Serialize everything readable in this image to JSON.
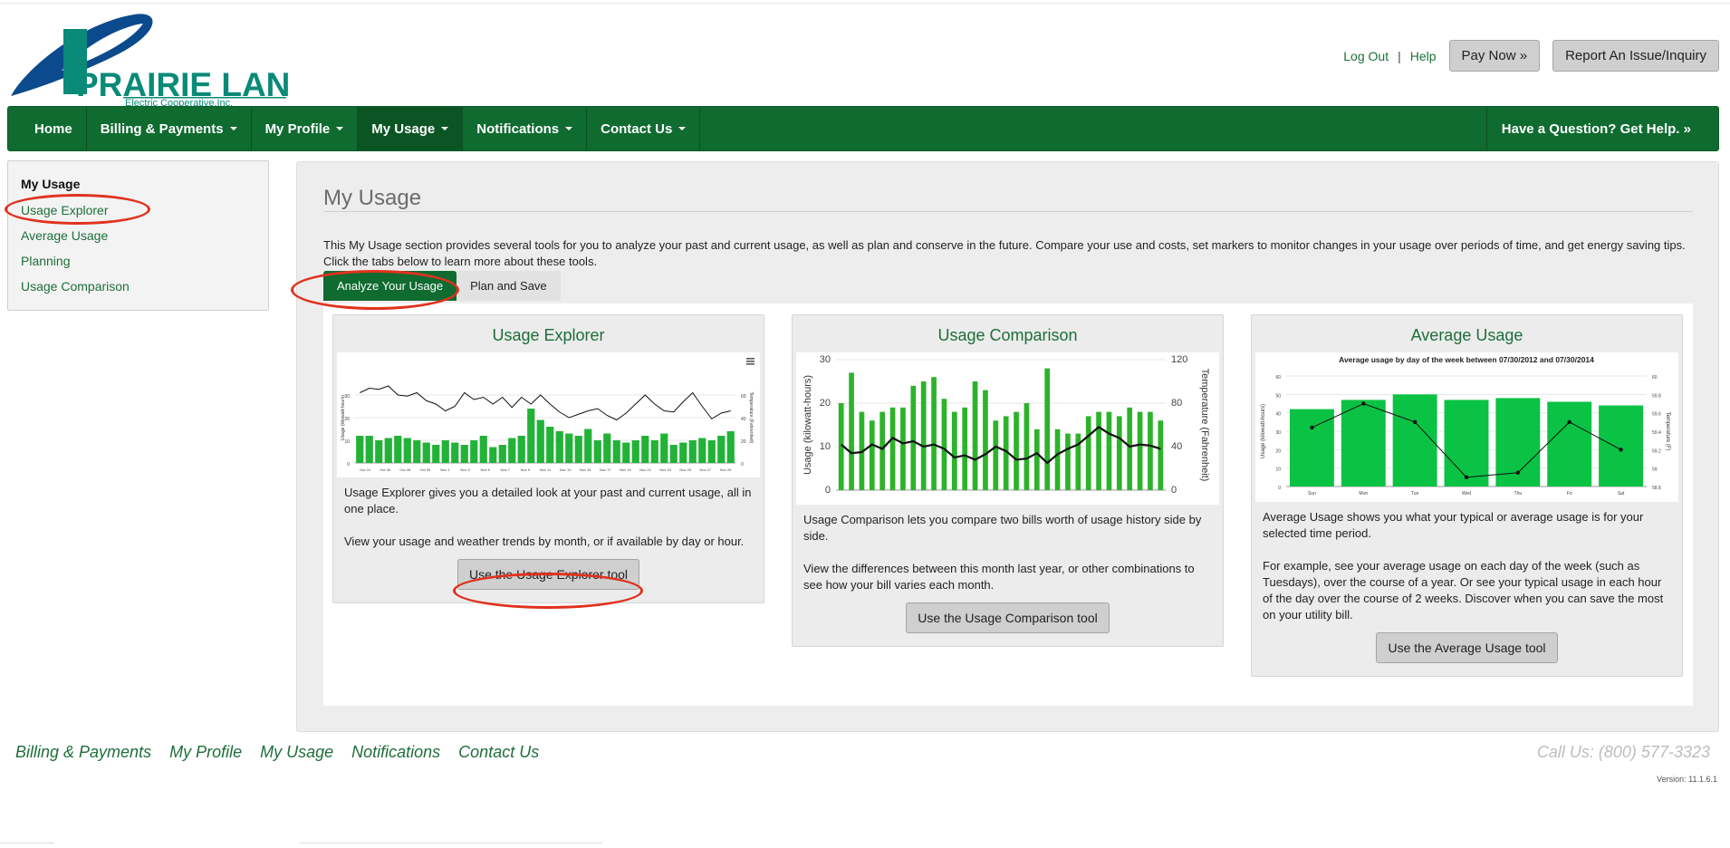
{
  "brand": {
    "name": "PRAIRIE LAND",
    "subtitle": "Electric Cooperative,Inc.",
    "green": "#0f6b30",
    "teal": "#0a8a78",
    "blue": "#0b4a8c"
  },
  "header": {
    "logout": "Log Out",
    "separator": "|",
    "help": "Help",
    "pay_now": "Pay Now »",
    "report": "Report An Issue/Inquiry"
  },
  "nav": {
    "items": [
      {
        "label": "Home",
        "dropdown": false
      },
      {
        "label": "Billing & Payments",
        "dropdown": true
      },
      {
        "label": "My Profile",
        "dropdown": true
      },
      {
        "label": "My Usage",
        "dropdown": true,
        "active": true
      },
      {
        "label": "Notifications",
        "dropdown": true
      },
      {
        "label": "Contact Us",
        "dropdown": true
      }
    ],
    "help": "Have a Question? Get Help. »"
  },
  "sidebar": {
    "title": "My Usage",
    "items": [
      "Usage Explorer",
      "Average Usage",
      "Planning",
      "Usage Comparison"
    ]
  },
  "main": {
    "title": "My Usage",
    "intro": "This My Usage section provides several tools for you to analyze your past and current usage, as well as plan and conserve in the future. Compare your use and costs, set markers to monitor changes in your usage over periods of time, and get energy saving tips. Click the tabs below to learn more about these tools.",
    "tabs": [
      "Analyze Your Usage",
      "Plan and Save"
    ]
  },
  "cards": {
    "explorer": {
      "title": "Usage Explorer",
      "text1": "Usage Explorer gives you a detailed look at your past and current usage, all in one place.",
      "text2": "View your usage and weather trends by month, or if available by day or hour.",
      "button": "Use the Usage Explorer tool"
    },
    "comparison": {
      "title": "Usage Comparison",
      "text1": "Usage Comparison lets you compare two bills worth of usage history side by side.",
      "text2": "View the differences between this month last year, or other combinations to see how your bill varies each month.",
      "button": "Use the Usage Comparison tool"
    },
    "average": {
      "title": "Average Usage",
      "text1": "Average Usage shows you what your typical or average usage is for your selected time period.",
      "text2": "For example, see your average usage on each day of the week (such as Tuesdays), over the course of a year. Or see your typical usage in each hour of the day over the course of 2 weeks. Discover when you can save the most on your utility bill.",
      "button": "Use the Average Usage tool"
    }
  },
  "chart_data": [
    {
      "type": "bar",
      "id": "explorer",
      "ylabel": "Usage (kilowatt-hours)",
      "y2label": "Temperature (Fahrenheit)",
      "ylim": [
        0,
        40
      ],
      "y2lim": [
        0,
        80
      ],
      "yticks": [
        0,
        10,
        20,
        30
      ],
      "y2ticks": [
        0,
        20,
        40,
        60
      ],
      "categories": [
        "Oct 24",
        "Oct 26",
        "Oct 28",
        "Oct 30",
        "Nov 1",
        "Nov 3",
        "Nov 5",
        "Nov 7",
        "Nov 9",
        "Nov 11",
        "Nov 13",
        "Nov 15",
        "Nov 17",
        "Nov 19",
        "Nov 21",
        "Nov 23",
        "Nov 25",
        "Nov 27",
        "Nov 29"
      ],
      "values": [
        12,
        12,
        10,
        11,
        12,
        11,
        10,
        9,
        8,
        10,
        9,
        8,
        10,
        12,
        7,
        8,
        11,
        12,
        24,
        19,
        16,
        14,
        13,
        12,
        15,
        10,
        13,
        10,
        9,
        10,
        12,
        10,
        13,
        8,
        9,
        10,
        11,
        10,
        12,
        14
      ],
      "temps": [
        62,
        66,
        65,
        68,
        60,
        59,
        62,
        55,
        52,
        46,
        50,
        62,
        56,
        58,
        52,
        58,
        49,
        58,
        52,
        60,
        52,
        45,
        40,
        43,
        46,
        48,
        42,
        38,
        44,
        52,
        60,
        52,
        46,
        45,
        54,
        62,
        50,
        39,
        44,
        46
      ]
    },
    {
      "type": "bar",
      "id": "comparison",
      "ylabel": "Usage (kilowatt-hours)",
      "y2label": "Temperature (Fahrenheit)",
      "ylim": [
        0,
        30
      ],
      "y2lim": [
        0,
        120
      ],
      "yticks": [
        0,
        10,
        20,
        30
      ],
      "y2ticks": [
        0,
        40,
        80,
        120
      ],
      "values": [
        20,
        27,
        18,
        16,
        18,
        19,
        19,
        24,
        25,
        26,
        21,
        18,
        19,
        25,
        23,
        16,
        17,
        18,
        20,
        14,
        28,
        14,
        13,
        13,
        17,
        18,
        18,
        17,
        19,
        18,
        18,
        16
      ],
      "temps": [
        42,
        34,
        35,
        42,
        38,
        48,
        43,
        45,
        40,
        42,
        38,
        30,
        32,
        28,
        33,
        40,
        36,
        28,
        29,
        34,
        25,
        33,
        38,
        42,
        50,
        58,
        52,
        48,
        40,
        42,
        41,
        38
      ]
    },
    {
      "type": "bar",
      "id": "average",
      "title": "Average usage by day of the week between 07/30/2012 and 07/30/2014",
      "ylabel": "Usage (kilowatt-hours)",
      "y2label": "Temperature (F)",
      "ylim": [
        0,
        60
      ],
      "y2lim": [
        58.8,
        60
      ],
      "yticks": [
        0,
        10,
        20,
        30,
        40,
        50,
        60
      ],
      "y2ticks": [
        58.8,
        59,
        59.2,
        59.4,
        59.6,
        59.8,
        60
      ],
      "categories": [
        "Sun",
        "Mon",
        "Tue",
        "Wed",
        "Thu",
        "Fri",
        "Sat"
      ],
      "values": [
        42,
        47,
        50,
        47,
        48,
        46,
        44
      ],
      "temps": [
        59.44,
        59.7,
        59.5,
        58.9,
        58.95,
        59.5,
        59.2
      ]
    }
  ],
  "footer": {
    "links": [
      "Billing & Payments",
      "My Profile",
      "My Usage",
      "Notifications",
      "Contact Us"
    ],
    "call": "Call Us: (800) 577-3323",
    "version": "Version: 11.1.6.1"
  }
}
